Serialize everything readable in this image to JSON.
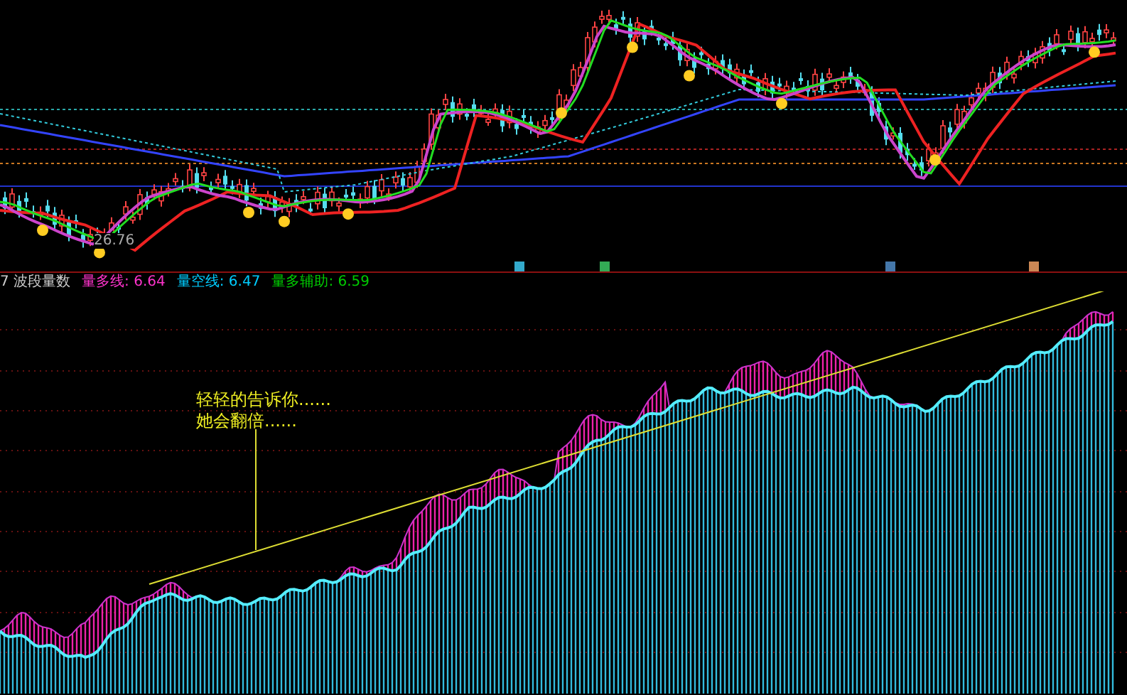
{
  "price_panel": {
    "low_label": "26.76"
  },
  "indicator": {
    "title": "7 波段量数",
    "legend": [
      {
        "name": "量多线:",
        "value": "6.64",
        "color": "#ff33cc"
      },
      {
        "name": "量空线:",
        "value": "6.47",
        "color": "#00ccff"
      },
      {
        "name": "量多辅助:",
        "value": "6.59",
        "color": "#00cc00"
      }
    ],
    "annotation": [
      "轻轻的告诉你......",
      "她会翻倍......"
    ]
  }
}
